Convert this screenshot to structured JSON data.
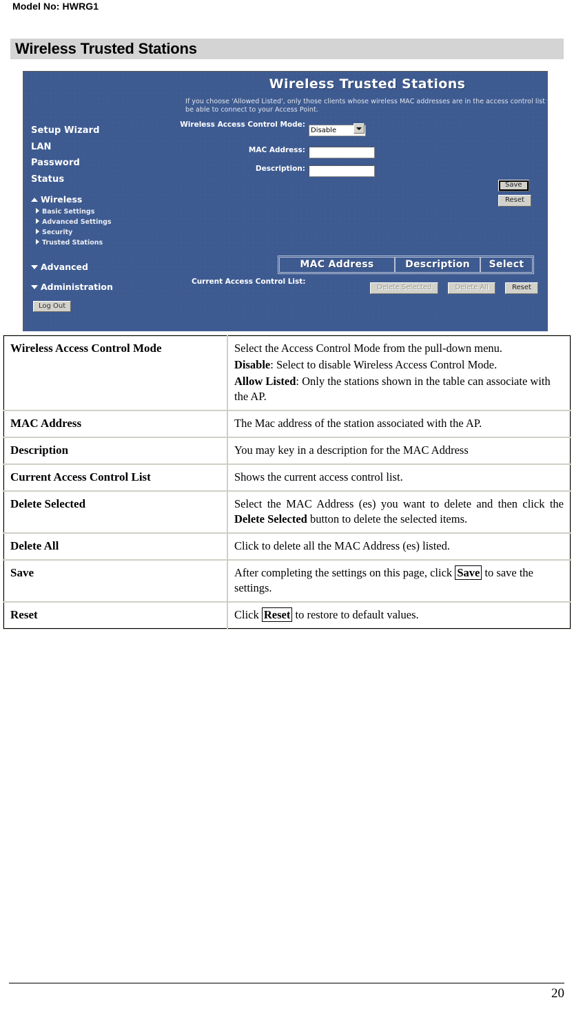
{
  "header": {
    "model_label": "Model No: HWRG1",
    "section_title": "Wireless Trusted Stations"
  },
  "router_ui": {
    "title": "Wireless Trusted Stations",
    "description": "If you choose 'Allowed Listed', only those clients whose wireless MAC addresses are in the access control list will be able to connect to your Access Point.",
    "sidebar": {
      "main_items": [
        "Setup Wizard",
        "LAN",
        "Password",
        "Status"
      ],
      "groups": [
        {
          "label": "Wireless",
          "expanded": true,
          "children": [
            "Basic Settings",
            "Advanced Settings",
            "Security",
            "Trusted Stations"
          ]
        },
        {
          "label": "Advanced",
          "expanded": false,
          "children": []
        },
        {
          "label": "Administration",
          "expanded": false,
          "children": []
        }
      ],
      "logout_label": "Log Out"
    },
    "form": {
      "mode_label": "Wireless Access Control Mode:",
      "mode_value": "Disable",
      "mode_options": [
        "Disable",
        "Allow Listed"
      ],
      "mac_label": "MAC Address:",
      "mac_value": "",
      "desc_label": "Description:",
      "desc_value": "",
      "save_label": "Save",
      "reset_label": "Reset"
    },
    "acl": {
      "label": "Current Access Control List:",
      "columns": [
        "MAC Address",
        "Description",
        "Select"
      ],
      "rows": [],
      "delete_selected_label": "Delete Selected",
      "delete_all_label": "Delete All",
      "reset_label": "Reset"
    },
    "colors": {
      "panel_bg": "#3e5b91",
      "button_face": "#d2d2cb",
      "section_bar": "#d4d4d4"
    }
  },
  "desc_table": {
    "rows": [
      {
        "key": "Wireless Access Control Mode",
        "lines": [
          {
            "text": "Select the Access Control Mode from the pull-down menu."
          },
          {
            "bold": "Disable",
            "text": ": Select to disable Wireless Access Control Mode."
          },
          {
            "bold": "Allow Listed",
            "text": ": Only the stations shown in the table can associate with the AP."
          }
        ]
      },
      {
        "key": "MAC Address",
        "lines": [
          {
            "text": "The Mac address of the station associated with the AP."
          }
        ]
      },
      {
        "key": "Description",
        "lines": [
          {
            "text": "You may key in a description for the MAC Address"
          }
        ]
      },
      {
        "key": "Current Access Control List",
        "lines": [
          {
            "text": "Shows the current access control list."
          }
        ]
      },
      {
        "key": "Delete Selected",
        "lines": [
          {
            "pre": "Select the MAC Address (es) you want to delete and then click the ",
            "bold": "Delete Selected",
            "text": " button to delete the selected items."
          }
        ]
      },
      {
        "key": "Delete All",
        "lines": [
          {
            "text": "Click to delete all the MAC Address (es) listed."
          }
        ]
      },
      {
        "key": "Save",
        "lines": [
          {
            "pre": "After completing the settings on this page, click ",
            "boxed": "Save",
            "text": " to save the settings."
          }
        ]
      },
      {
        "key": "Reset",
        "lines": [
          {
            "pre": "Click ",
            "boxed": "Reset",
            "text": " to restore to default values."
          }
        ]
      }
    ]
  },
  "footer": {
    "page_number": "20"
  }
}
